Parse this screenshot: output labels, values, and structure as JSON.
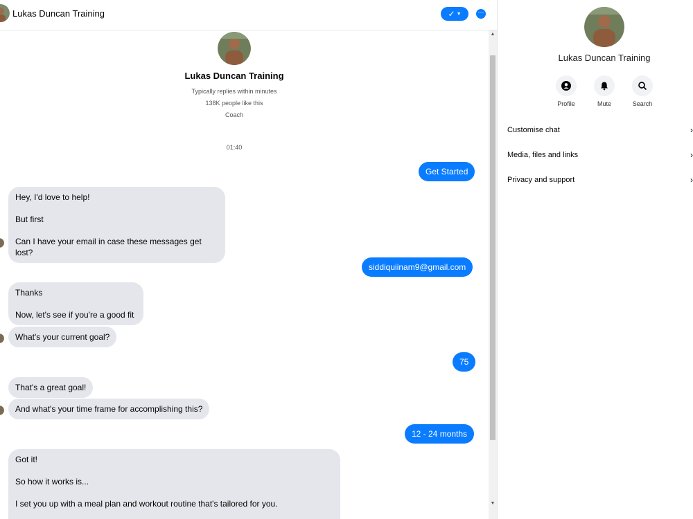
{
  "header": {
    "title": "Lukas Duncan Training",
    "check_icon": "check-icon",
    "more_icon": "more-icon"
  },
  "profile": {
    "name": "Lukas Duncan Training",
    "meta": [
      "Typically replies within minutes",
      "138K people like this",
      "Coach"
    ]
  },
  "conversation": {
    "timestamp": "01:40",
    "messages": {
      "m1": "Get Started",
      "m2": [
        "Hey, I'd love to help!",
        "But first",
        "Can I have your email in case these messages get lost?"
      ],
      "m3": "siddiquiinam9@gmail.com",
      "m4": [
        "Thanks",
        "Now, let's see if you're a good fit"
      ],
      "m5": "What's your current goal?",
      "m6": "75",
      "m7": "That's a great goal!",
      "m8": "And what's your time frame for accomplishing this?",
      "m9": "12 - 24 months",
      "m10": [
        "Got it!",
        "So how it works is...",
        "I set you up with a meal plan and workout routine that's tailored for you."
      ]
    }
  },
  "side_panel": {
    "name": "Lukas Duncan Training",
    "actions": [
      {
        "label": "Profile",
        "icon": "profile-icon"
      },
      {
        "label": "Mute",
        "icon": "bell-icon"
      },
      {
        "label": "Search",
        "icon": "search-icon"
      }
    ],
    "menu": [
      "Customise chat",
      "Media, files and links",
      "Privacy and support"
    ]
  },
  "colors": {
    "accent": "#0a7cff",
    "incoming_bubble": "#e4e6eb"
  }
}
